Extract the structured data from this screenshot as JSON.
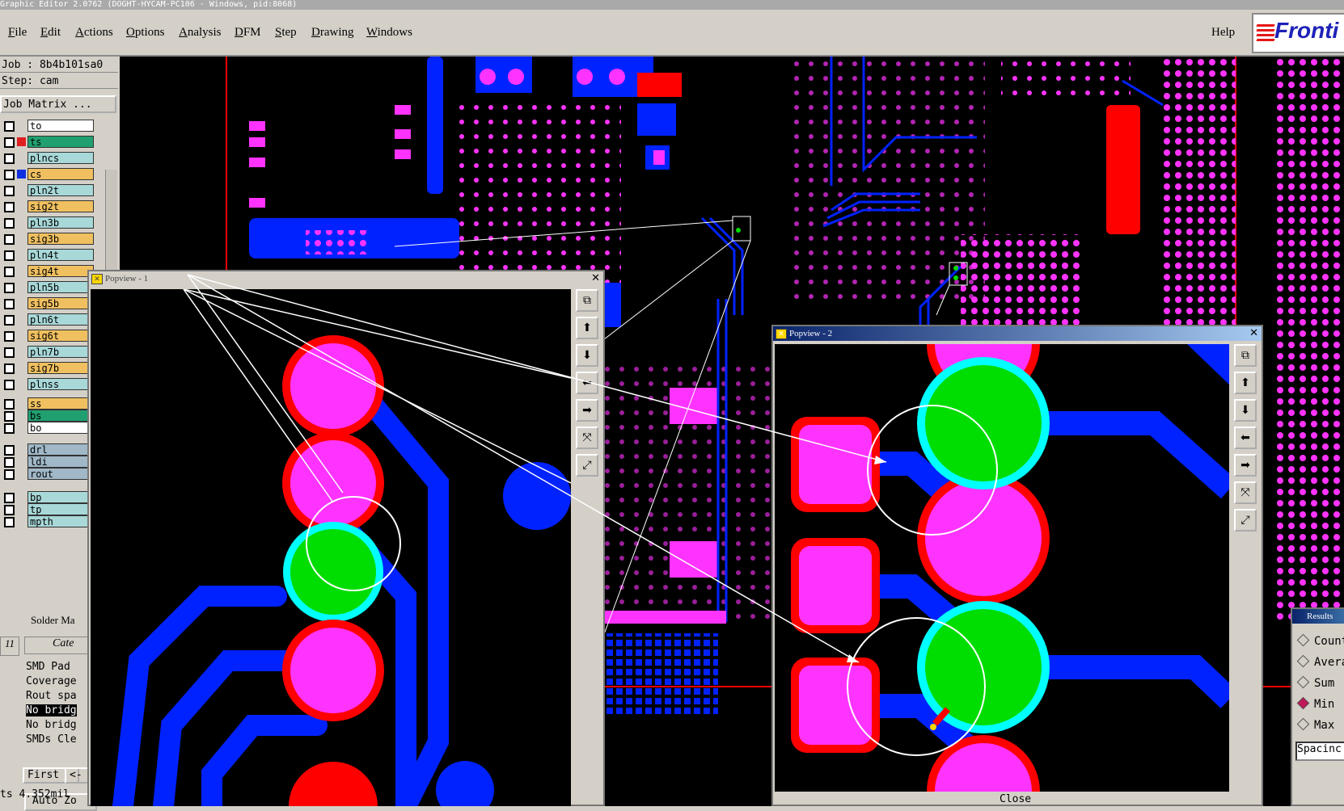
{
  "window": {
    "title": "Graphic Editor 2.0762 (DOGHT-HYCAM-PC106 - Windows, pid:8068)"
  },
  "menu": {
    "items": [
      "File",
      "Edit",
      "Actions",
      "Options",
      "Analysis",
      "DFM",
      "Step",
      "Drawing",
      "Windows"
    ],
    "help": "Help",
    "logo": "Fronti"
  },
  "left": {
    "job": "Job : 8b4b101sa0",
    "step": "Step: cam",
    "job_matrix": "Job Matrix ...",
    "layers": [
      {
        "name": "to",
        "color": "#ffffff"
      },
      {
        "name": "ts",
        "color": "#20a070"
      },
      {
        "name": "plncs",
        "color": "#a8d8d8"
      },
      {
        "name": "cs",
        "color": "#f0c060"
      },
      {
        "name": "pln2t",
        "color": "#a8d8d8"
      },
      {
        "name": "sig2t",
        "color": "#f0c060"
      },
      {
        "name": "pln3b",
        "color": "#a8d8d8"
      },
      {
        "name": "sig3b",
        "color": "#f0c060"
      },
      {
        "name": "pln4t",
        "color": "#a8d8d8"
      },
      {
        "name": "sig4t",
        "color": "#f0c060"
      },
      {
        "name": "pln5b",
        "color": "#a8d8d8"
      },
      {
        "name": "sig5b",
        "color": "#f0c060"
      },
      {
        "name": "pln6t",
        "color": "#a8d8d8"
      },
      {
        "name": "sig6t",
        "color": "#f0c060"
      },
      {
        "name": "pln7b",
        "color": "#a8d8d8"
      },
      {
        "name": "sig7b",
        "color": "#f0c060"
      },
      {
        "name": "plnss",
        "color": "#a8d8d8"
      },
      {
        "name": "ss",
        "color": "#f0c060"
      },
      {
        "name": "bs",
        "color": "#20a070"
      },
      {
        "name": "bo",
        "color": "#ffffff"
      },
      {
        "name": "drl",
        "color": "#a0b8c8"
      },
      {
        "name": "ldi",
        "color": "#a0b8c8"
      },
      {
        "name": "rout",
        "color": "#a0b8c8"
      },
      {
        "name": "bp",
        "color": "#a8d8d8"
      },
      {
        "name": "tp",
        "color": "#a8d8d8"
      },
      {
        "name": "mpth",
        "color": "#a8d8d8"
      }
    ],
    "solder_label": "Solder Ma",
    "category_header": "Cate",
    "list_marker": "11",
    "results": [
      "SMD Pad",
      "Coverage",
      "Rout spa",
      "No bridg",
      "No bridg",
      "SMDs Cle"
    ],
    "first_button": "First",
    "prev_button": "<-",
    "autozoom_button": "Auto Zo",
    "status": "ts 4.352mil"
  },
  "popview1": {
    "title": "Popview - 1"
  },
  "popview2": {
    "title": "Popview - 2",
    "close": "Close"
  },
  "results_panel": {
    "title": "Results",
    "options": [
      "Count",
      "Avera",
      "Sum",
      "Min",
      "Max"
    ],
    "selected": "Min",
    "field": "Spacinc"
  },
  "colors": {
    "pad": "#ff33ff",
    "pad_outline": "#ff0000",
    "trace": "#0022ff",
    "hit": "#00dd00",
    "mask": "#00ffff"
  }
}
